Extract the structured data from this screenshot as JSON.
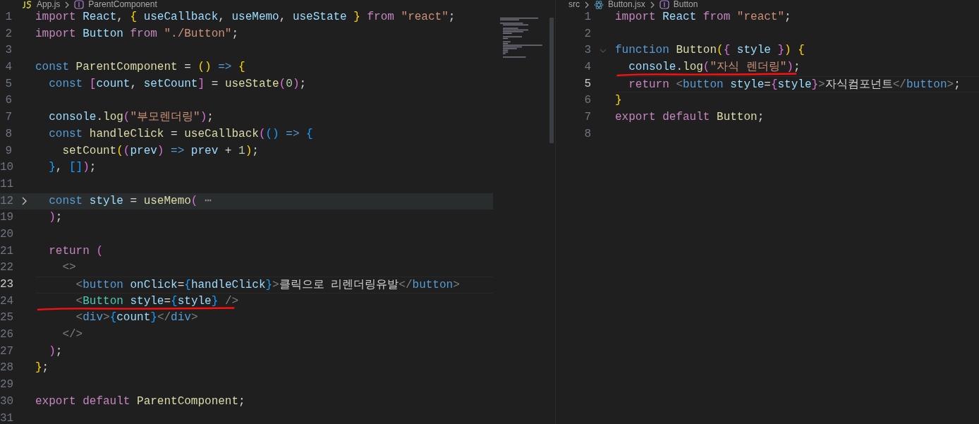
{
  "panes": [
    {
      "breadcrumb": [
        {
          "kind": "js",
          "text": "App.js"
        },
        {
          "kind": "symbol",
          "text": "ParentComponent"
        }
      ],
      "minimap": true,
      "lines": [
        {
          "number": "1",
          "tokens": [
            {
              "kind": "kw",
              "text": "import "
            },
            {
              "kind": "var",
              "text": "React"
            },
            {
              "kind": "punc",
              "text": ", "
            },
            {
              "kind": "b1",
              "text": "{ "
            },
            {
              "kind": "var",
              "text": "useCallback"
            },
            {
              "kind": "punc",
              "text": ", "
            },
            {
              "kind": "var",
              "text": "useMemo"
            },
            {
              "kind": "punc",
              "text": ", "
            },
            {
              "kind": "var",
              "text": "useState "
            },
            {
              "kind": "b1",
              "text": "} "
            },
            {
              "kind": "kw",
              "text": "from "
            },
            {
              "kind": "str",
              "text": "\"react\""
            },
            {
              "kind": "punc",
              "text": ";"
            }
          ]
        },
        {
          "number": "2",
          "tokens": [
            {
              "kind": "kw",
              "text": "import "
            },
            {
              "kind": "var",
              "text": "Button "
            },
            {
              "kind": "kw",
              "text": "from "
            },
            {
              "kind": "str",
              "text": "\"./Button\""
            },
            {
              "kind": "punc",
              "text": ";"
            }
          ]
        },
        {
          "number": "3"
        },
        {
          "number": "4",
          "tokens": [
            {
              "kind": "decl",
              "text": "const "
            },
            {
              "kind": "fn",
              "text": "ParentComponent"
            },
            {
              "kind": "punc",
              "text": " = "
            },
            {
              "kind": "b1",
              "text": "() "
            },
            {
              "kind": "decl",
              "text": "=> "
            },
            {
              "kind": "b1",
              "text": "{"
            }
          ]
        },
        {
          "number": "5",
          "tokens": [
            {
              "kind": "decl",
              "text": "  const "
            },
            {
              "kind": "b2",
              "text": "["
            },
            {
              "kind": "var",
              "text": "count"
            },
            {
              "kind": "punc",
              "text": ", "
            },
            {
              "kind": "var",
              "text": "setCount"
            },
            {
              "kind": "b2",
              "text": "]"
            },
            {
              "kind": "punc",
              "text": " = "
            },
            {
              "kind": "fn",
              "text": "useState"
            },
            {
              "kind": "b2",
              "text": "("
            },
            {
              "kind": "num",
              "text": "0"
            },
            {
              "kind": "b2",
              "text": ")"
            },
            {
              "kind": "punc",
              "text": ";"
            }
          ]
        },
        {
          "number": "6"
        },
        {
          "number": "7",
          "tokens": [
            {
              "kind": "var",
              "text": "  console"
            },
            {
              "kind": "punc",
              "text": "."
            },
            {
              "kind": "fn",
              "text": "log"
            },
            {
              "kind": "b2",
              "text": "("
            },
            {
              "kind": "str",
              "text": "\"부모렌더링\""
            },
            {
              "kind": "b2",
              "text": ")"
            },
            {
              "kind": "punc",
              "text": ";"
            }
          ]
        },
        {
          "number": "8",
          "tokens": [
            {
              "kind": "decl",
              "text": "  const "
            },
            {
              "kind": "fn",
              "text": "handleClick"
            },
            {
              "kind": "punc",
              "text": " = "
            },
            {
              "kind": "fn",
              "text": "useCallback"
            },
            {
              "kind": "b2",
              "text": "("
            },
            {
              "kind": "b3",
              "text": "() "
            },
            {
              "kind": "decl",
              "text": "=> "
            },
            {
              "kind": "b3",
              "text": "{"
            }
          ]
        },
        {
          "number": "9",
          "tokens": [
            {
              "kind": "fn",
              "text": "    setCount"
            },
            {
              "kind": "b1",
              "text": "("
            },
            {
              "kind": "b2",
              "text": "("
            },
            {
              "kind": "var",
              "text": "prev"
            },
            {
              "kind": "b2",
              "text": ") "
            },
            {
              "kind": "decl",
              "text": "=> "
            },
            {
              "kind": "var",
              "text": "prev"
            },
            {
              "kind": "punc",
              "text": " + "
            },
            {
              "kind": "num",
              "text": "1"
            },
            {
              "kind": "b1",
              "text": ")"
            },
            {
              "kind": "punc",
              "text": ";"
            }
          ]
        },
        {
          "number": "10",
          "tokens": [
            {
              "kind": "b3",
              "text": "  }"
            },
            {
              "kind": "punc",
              "text": ", "
            },
            {
              "kind": "b3",
              "text": "[]"
            },
            {
              "kind": "b2",
              "text": ")"
            },
            {
              "kind": "punc",
              "text": ";"
            }
          ]
        },
        {
          "number": "11"
        },
        {
          "number": "12",
          "folded": true,
          "tokens": [
            {
              "kind": "decl",
              "text": "  const "
            },
            {
              "kind": "var",
              "text": "style"
            },
            {
              "kind": "punc",
              "text": " = "
            },
            {
              "kind": "fn",
              "text": "useMemo"
            },
            {
              "kind": "b2",
              "text": "( "
            },
            {
              "kind": "fold",
              "text": "⋯"
            }
          ]
        },
        {
          "number": "19",
          "tokens": [
            {
              "kind": "b2",
              "text": "  )"
            },
            {
              "kind": "punc",
              "text": ";"
            }
          ]
        },
        {
          "number": "20"
        },
        {
          "number": "21",
          "tokens": [
            {
              "kind": "kw",
              "text": "  return "
            },
            {
              "kind": "b2",
              "text": "("
            }
          ]
        },
        {
          "number": "22",
          "tokens": [
            {
              "kind": "angle",
              "text": "    <>"
            }
          ]
        },
        {
          "number": "23",
          "current": true,
          "tokens": [
            {
              "kind": "angle",
              "text": "      <"
            },
            {
              "kind": "tag",
              "text": "button "
            },
            {
              "kind": "var",
              "text": "onClick"
            },
            {
              "kind": "punc",
              "text": "="
            },
            {
              "kind": "b3",
              "text": "{"
            },
            {
              "kind": "var",
              "text": "handleClick"
            },
            {
              "kind": "b3",
              "text": "}"
            },
            {
              "kind": "angle",
              "text": ">"
            },
            {
              "kind": "punc",
              "text": "클릭으로 리렌더링유발"
            },
            {
              "kind": "angle",
              "text": "</"
            },
            {
              "kind": "tag",
              "text": "button"
            },
            {
              "kind": "angle",
              "text": ">"
            }
          ]
        },
        {
          "number": "24",
          "marked": true,
          "tokens": [
            {
              "kind": "angle",
              "text": "      <"
            },
            {
              "kind": "comp",
              "text": "Button "
            },
            {
              "kind": "var",
              "text": "style"
            },
            {
              "kind": "punc",
              "text": "="
            },
            {
              "kind": "b3",
              "text": "{"
            },
            {
              "kind": "var",
              "text": "style"
            },
            {
              "kind": "b3",
              "text": "} "
            },
            {
              "kind": "angle",
              "text": "/>"
            }
          ]
        },
        {
          "number": "25",
          "tokens": [
            {
              "kind": "angle",
              "text": "      <"
            },
            {
              "kind": "tag",
              "text": "div"
            },
            {
              "kind": "angle",
              "text": ">"
            },
            {
              "kind": "b3",
              "text": "{"
            },
            {
              "kind": "var",
              "text": "count"
            },
            {
              "kind": "b3",
              "text": "}"
            },
            {
              "kind": "angle",
              "text": "</"
            },
            {
              "kind": "tag",
              "text": "div"
            },
            {
              "kind": "angle",
              "text": ">"
            }
          ]
        },
        {
          "number": "26",
          "tokens": [
            {
              "kind": "angle",
              "text": "    </>"
            }
          ]
        },
        {
          "number": "27",
          "tokens": [
            {
              "kind": "b2",
              "text": "  )"
            },
            {
              "kind": "punc",
              "text": ";"
            }
          ]
        },
        {
          "number": "28",
          "tokens": [
            {
              "kind": "b1",
              "text": "}"
            },
            {
              "kind": "punc",
              "text": ";"
            }
          ]
        },
        {
          "number": "29"
        },
        {
          "number": "30",
          "tokens": [
            {
              "kind": "kw",
              "text": "export default "
            },
            {
              "kind": "fn",
              "text": "ParentComponent"
            },
            {
              "kind": "punc",
              "text": ";"
            }
          ]
        },
        {
          "number": "31"
        }
      ]
    },
    {
      "breadcrumb": [
        {
          "kind": "folder",
          "text": "src"
        },
        {
          "kind": "jsx",
          "text": "Button.jsx"
        },
        {
          "kind": "symbol",
          "text": "Button"
        }
      ],
      "minimap": false,
      "lines": [
        {
          "number": "1",
          "tokens": [
            {
              "kind": "kw",
              "text": "import "
            },
            {
              "kind": "var",
              "text": "React "
            },
            {
              "kind": "kw",
              "text": "from "
            },
            {
              "kind": "str",
              "text": "\"react\""
            },
            {
              "kind": "punc",
              "text": ";"
            }
          ]
        },
        {
          "number": "2"
        },
        {
          "number": "3",
          "foldable": true,
          "tokens": [
            {
              "kind": "decl",
              "text": "function "
            },
            {
              "kind": "fn",
              "text": "Button"
            },
            {
              "kind": "b1",
              "text": "("
            },
            {
              "kind": "b2",
              "text": "{ "
            },
            {
              "kind": "var",
              "text": "style "
            },
            {
              "kind": "b2",
              "text": "}"
            },
            {
              "kind": "b1",
              "text": ") {"
            }
          ]
        },
        {
          "number": "4",
          "marked": true,
          "tokens": [
            {
              "kind": "var",
              "text": "  console"
            },
            {
              "kind": "punc",
              "text": "."
            },
            {
              "kind": "fn",
              "text": "log"
            },
            {
              "kind": "b2",
              "text": "("
            },
            {
              "kind": "str",
              "text": "\"자식 렌더링\""
            },
            {
              "kind": "b2",
              "text": ")"
            },
            {
              "kind": "punc",
              "text": ";"
            }
          ]
        },
        {
          "number": "5",
          "current": true,
          "tokens": [
            {
              "kind": "kw",
              "text": "  return "
            },
            {
              "kind": "angle",
              "text": "<"
            },
            {
              "kind": "tag",
              "text": "button "
            },
            {
              "kind": "var",
              "text": "style"
            },
            {
              "kind": "punc",
              "text": "="
            },
            {
              "kind": "b2",
              "text": "{"
            },
            {
              "kind": "var",
              "text": "style"
            },
            {
              "kind": "b2",
              "text": "}"
            },
            {
              "kind": "angle",
              "text": ">"
            },
            {
              "kind": "punc",
              "text": "자식컴포넌트"
            },
            {
              "kind": "angle",
              "text": "</"
            },
            {
              "kind": "tag",
              "text": "button"
            },
            {
              "kind": "angle",
              "text": ">"
            },
            {
              "kind": "punc",
              "text": ";"
            }
          ]
        },
        {
          "number": "6",
          "tokens": [
            {
              "kind": "b1",
              "text": "}"
            }
          ]
        },
        {
          "number": "7",
          "tokens": [
            {
              "kind": "kw",
              "text": "export default "
            },
            {
              "kind": "fn",
              "text": "Button"
            },
            {
              "kind": "punc",
              "text": ";"
            }
          ]
        },
        {
          "number": "8"
        }
      ]
    }
  ]
}
